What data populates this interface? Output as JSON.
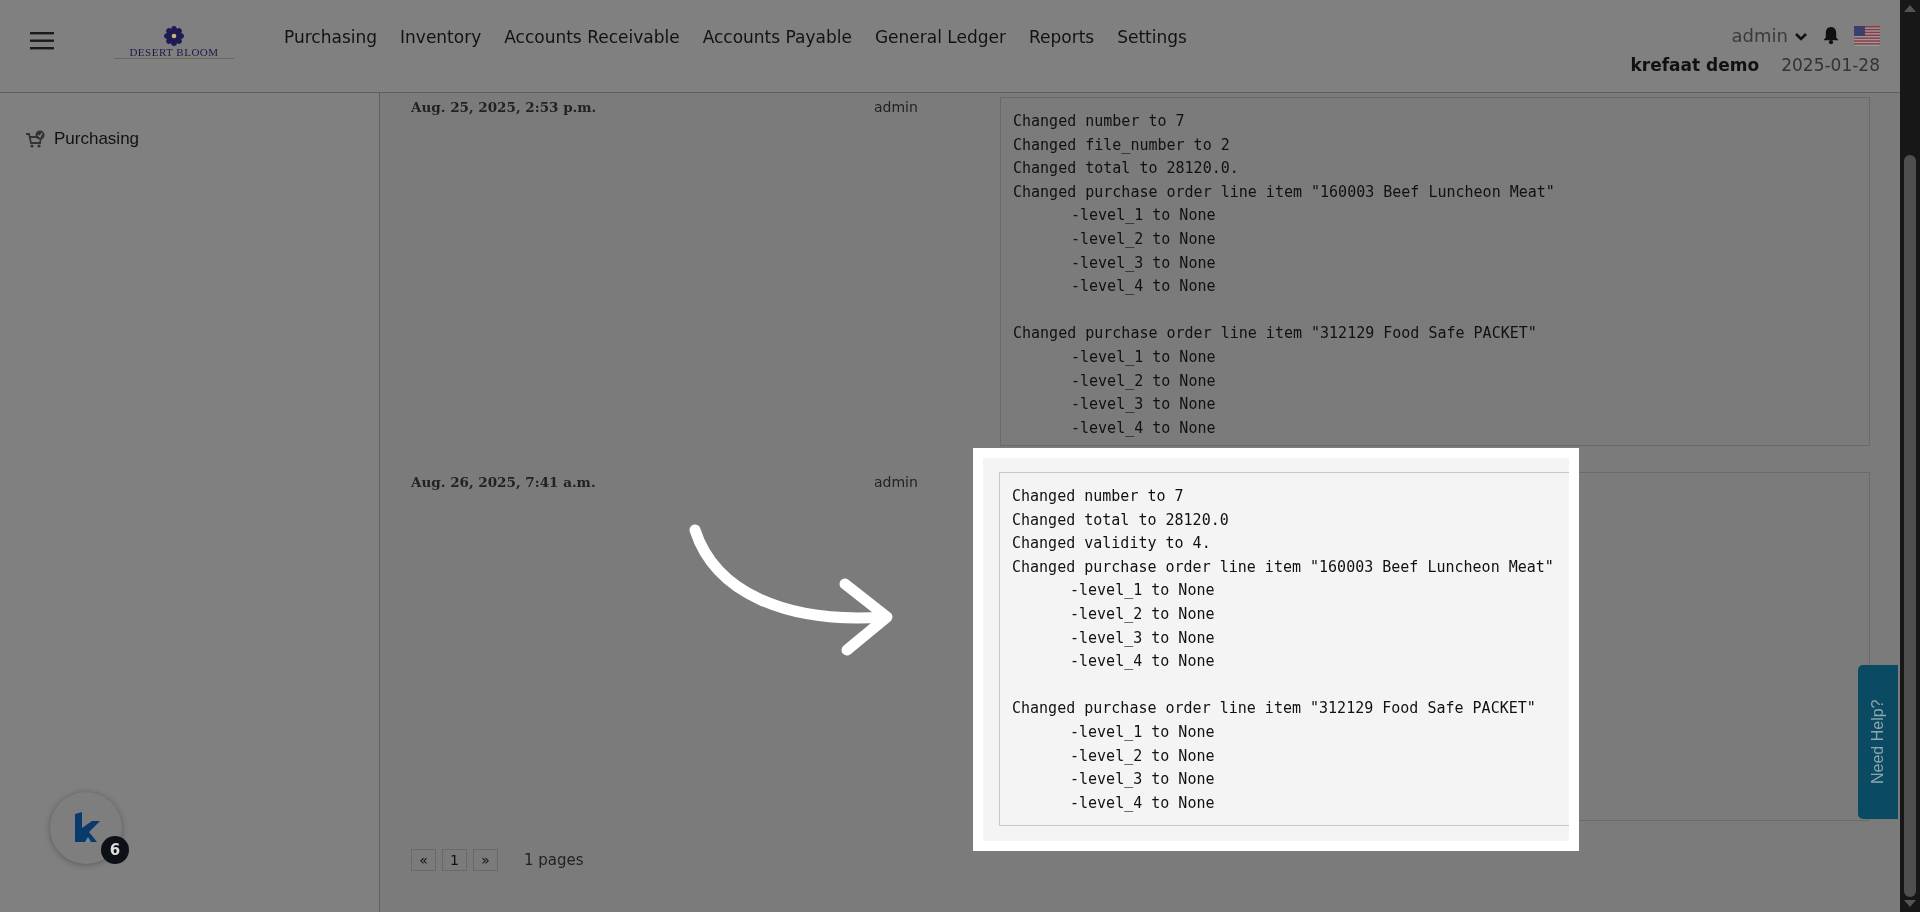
{
  "header": {
    "brand": "DESERT BLOOM",
    "nav": [
      "Purchasing",
      "Inventory",
      "Accounts Receivable",
      "Accounts Payable",
      "General Ledger",
      "Reports",
      "Settings"
    ],
    "user": "admin",
    "company": "krefaat demo",
    "date": "2025-01-28"
  },
  "sidebar": {
    "items": [
      {
        "label": "Purchasing"
      }
    ]
  },
  "history": [
    {
      "date": "Aug. 25, 2025, 2:53 p.m.",
      "user": "admin",
      "highlighted": false,
      "changes": [
        {
          "text": "Changed number to 7"
        },
        {
          "text": "Changed file_number to 2"
        },
        {
          "text": "Changed total to 28120.0."
        },
        {
          "text": "Changed purchase order line item \"160003 Beef Luncheon Meat\"",
          "details": [
            "-level_1 to None",
            "-level_2 to None",
            "-level_3 to None",
            "-level_4 to None"
          ]
        },
        {
          "text": "Changed purchase order line item \"312129 Food Safe PACKET\"",
          "details": [
            "-level_1 to None",
            "-level_2 to None",
            "-level_3 to None",
            "-level_4 to None"
          ]
        }
      ]
    },
    {
      "date": "Aug. 26, 2025, 7:41 a.m.",
      "user": "admin",
      "highlighted": true,
      "changes": [
        {
          "text": "Changed number to 7"
        },
        {
          "text": "Changed total to 28120.0"
        },
        {
          "text": "Changed validity to 4."
        },
        {
          "text": "Changed purchase order line item \"160003 Beef Luncheon Meat\"",
          "details": [
            "-level_1 to None",
            "-level_2 to None",
            "-level_3 to None",
            "-level_4 to None"
          ]
        },
        {
          "text": "Changed purchase order line item \"312129 Food Safe PACKET\"",
          "details": [
            "-level_1 to None",
            "-level_2 to None",
            "-level_3 to None",
            "-level_4 to None"
          ]
        }
      ]
    }
  ],
  "pagination": {
    "prev": "«",
    "page": "1",
    "next": "»",
    "summary": "1 pages"
  },
  "chat_launcher": {
    "count": "6"
  },
  "help_tab": {
    "label": "Need Help?"
  }
}
